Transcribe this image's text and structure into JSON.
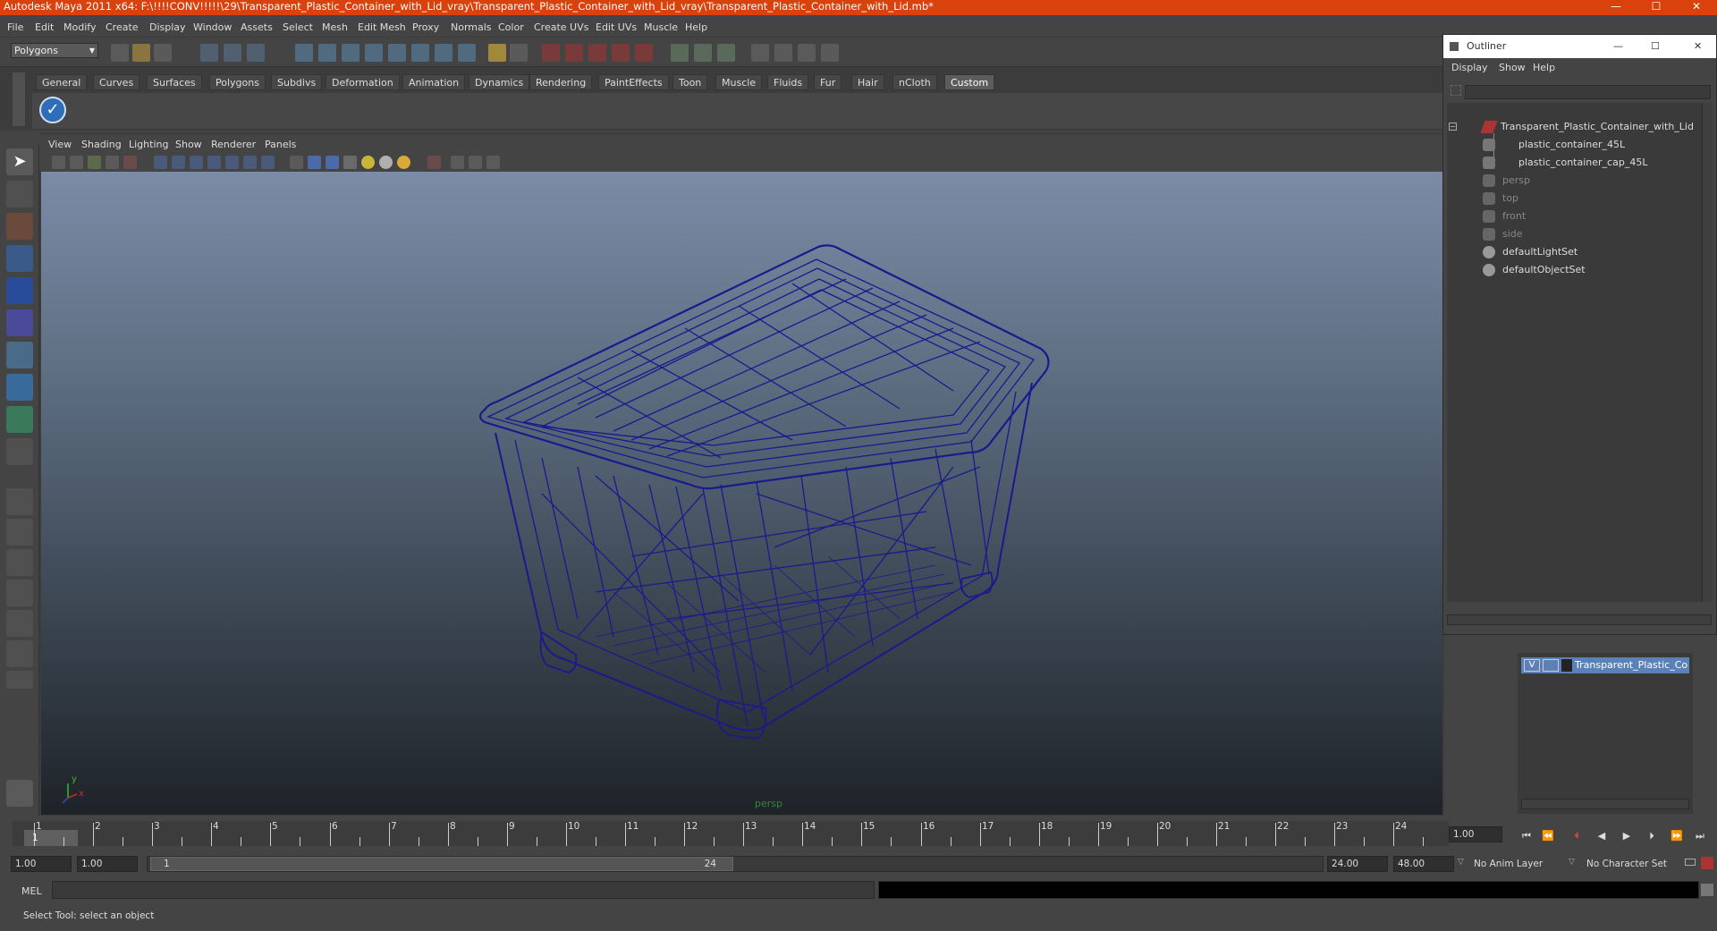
{
  "window": {
    "title": "Autodesk Maya 2011 x64: F:\\!!!!CONV!!!!!\\29\\Transparent_Plastic_Container_with_Lid_vray\\Transparent_Plastic_Container_with_Lid_vray\\Transparent_Plastic_Container_with_Lid.mb*",
    "controls": [
      "—",
      "☐",
      "✕"
    ]
  },
  "menubar": [
    "File",
    "Edit",
    "Modify",
    "Create",
    "Display",
    "Window",
    "Assets",
    "Select",
    "Mesh",
    "Edit Mesh",
    "Proxy",
    "Normals",
    "Color",
    "Create UVs",
    "Edit UVs",
    "Muscle",
    "Help"
  ],
  "status": {
    "mode": "Polygons"
  },
  "shelf": {
    "tabs": [
      "General",
      "Curves",
      "Surfaces",
      "Polygons",
      "Subdivs",
      "Deformation",
      "Animation",
      "Dynamics",
      "Rendering",
      "PaintEffects",
      "Toon",
      "Muscle",
      "Fluids",
      "Fur",
      "Hair",
      "nCloth",
      "Custom"
    ],
    "active": "Custom"
  },
  "viewport": {
    "menu": [
      "View",
      "Shading",
      "Lighting",
      "Show",
      "Renderer",
      "Panels"
    ],
    "camera": "persp",
    "axis_y": "y",
    "axis_x": "x"
  },
  "outliner": {
    "title": "Outliner",
    "menu": [
      "Display",
      "Show",
      "Help"
    ],
    "items": [
      {
        "label": "Transparent_Plastic_Container_with_Lid",
        "dim": false
      },
      {
        "label": "plastic_container_45L",
        "dim": false
      },
      {
        "label": "plastic_container_cap_45L",
        "dim": false
      },
      {
        "label": "persp",
        "dim": true
      },
      {
        "label": "top",
        "dim": true
      },
      {
        "label": "front",
        "dim": true
      },
      {
        "label": "side",
        "dim": true
      },
      {
        "label": "defaultLightSet",
        "dim": false
      },
      {
        "label": "defaultObjectSet",
        "dim": false
      }
    ]
  },
  "layers": {
    "visible_flag": "V",
    "layer_name": "Transparent_Plastic_Con"
  },
  "timeline": {
    "ticks": [
      "1",
      "2",
      "3",
      "4",
      "5",
      "6",
      "7",
      "8",
      "9",
      "10",
      "11",
      "12",
      "13",
      "14",
      "15",
      "16",
      "17",
      "18",
      "19",
      "20",
      "21",
      "22",
      "23",
      "24"
    ],
    "current_frame": "1",
    "current_time_field": "1.00"
  },
  "range": {
    "start_time": "1.00",
    "start_range": "1.00",
    "slider_start": "1",
    "slider_end": "24",
    "end_range": "24.00",
    "end_time": "48.00",
    "anim_layer": "No Anim Layer",
    "char_set": "No Character Set"
  },
  "command": {
    "lang": "MEL"
  },
  "help": {
    "text": "Select Tool: select an object"
  },
  "colors": {
    "titlebar": "#d9410d",
    "wireframe": "#1a1a8c",
    "camera_label": "#2c8b3d"
  }
}
